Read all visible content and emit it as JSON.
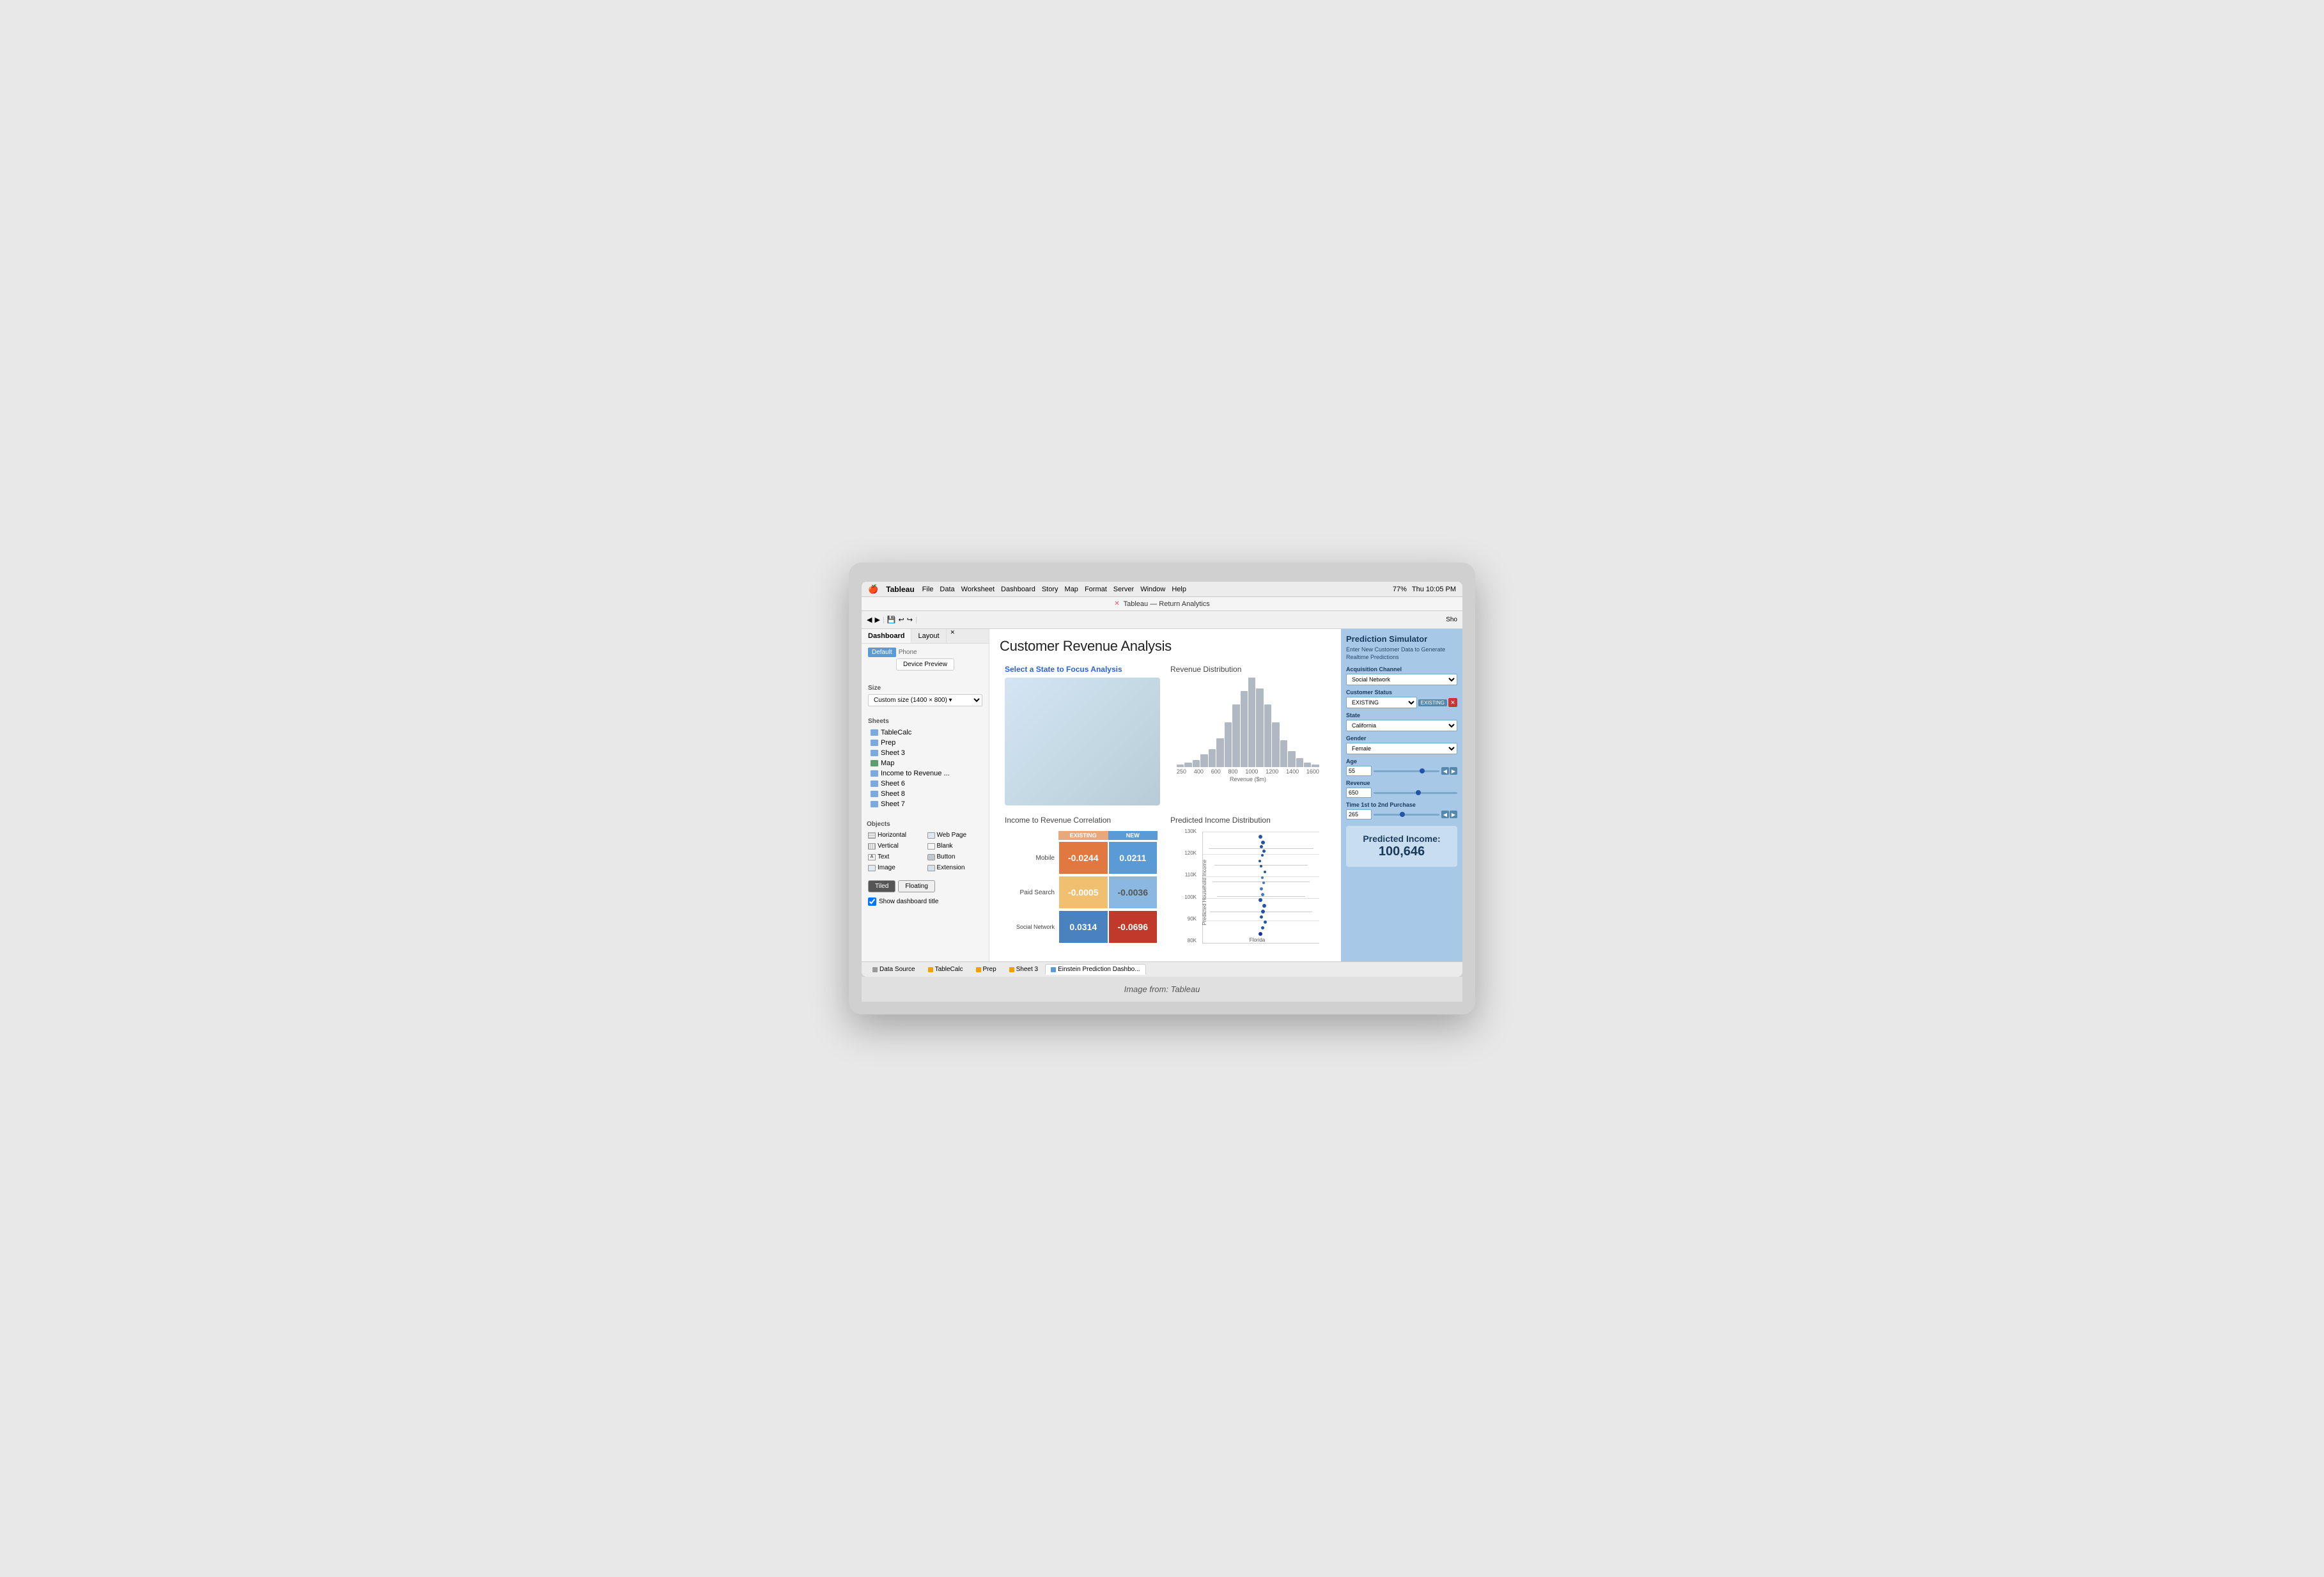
{
  "window": {
    "title": "Tableau — Return Analytics",
    "caption": "Image from: Tableau"
  },
  "menubar": {
    "apple": "⌘",
    "app": "Tableau",
    "menus": [
      "File",
      "Data",
      "Worksheet",
      "Dashboard",
      "Story",
      "Map",
      "Format",
      "Server",
      "Window",
      "Help"
    ],
    "time": "Thu 10:05 PM",
    "battery": "77%"
  },
  "sidebar": {
    "tabs": [
      "Dashboard",
      "Layout"
    ],
    "active_tab": "Dashboard",
    "default_label": "Default",
    "phone_label": "Phone",
    "device_preview_btn": "Device Preview",
    "size_label": "Size",
    "size_value": "Custom size (1400 × 800)  ▾",
    "sheets_label": "Sheets",
    "sheets": [
      {
        "name": "TableCalc",
        "type": "sheet"
      },
      {
        "name": "Prep",
        "type": "sheet"
      },
      {
        "name": "Sheet 3",
        "type": "sheet"
      },
      {
        "name": "Map",
        "type": "map"
      },
      {
        "name": "Income to Revenue ...",
        "type": "sheet"
      },
      {
        "name": "Sheet 6",
        "type": "sheet"
      },
      {
        "name": "Sheet 8",
        "type": "sheet"
      },
      {
        "name": "Sheet 7",
        "type": "sheet"
      }
    ],
    "objects_label": "Objects",
    "objects": [
      {
        "name": "Horizontal",
        "col": 1
      },
      {
        "name": "Web Page",
        "col": 2
      },
      {
        "name": "Vertical",
        "col": 1
      },
      {
        "name": "Blank",
        "col": 2
      },
      {
        "name": "Text",
        "col": 1
      },
      {
        "name": "Button",
        "col": 2
      },
      {
        "name": "Image",
        "col": 1
      },
      {
        "name": "Extension",
        "col": 2
      }
    ],
    "tiled_label": "Tiled",
    "floating_label": "Floating",
    "show_title_label": "Show dashboard title"
  },
  "dashboard": {
    "title": "Customer Revenue Analysis",
    "map_section": {
      "title_prefix": "Select a State to ",
      "title_highlight": "Focus Analysis"
    },
    "revenue_section": {
      "title": "Revenue Distribution",
      "x_labels": [
        "250",
        "400",
        "600",
        "800",
        "1000",
        "1200",
        "1400",
        "1600"
      ],
      "x_axis_label": "Revenue ($m)",
      "bars": [
        2,
        3,
        5,
        8,
        12,
        20,
        35,
        55,
        70,
        85,
        90,
        80,
        60,
        40,
        25,
        15,
        8,
        4,
        2
      ]
    },
    "correlation_section": {
      "title": "Income to Revenue Correlation",
      "col_existing": "EXISTING",
      "col_new": "NEW",
      "rows": [
        {
          "label": "Mobile",
          "existing_val": "-0.0244",
          "new_val": "0.0211"
        },
        {
          "label": "Paid Search",
          "existing_val": "-0.0005",
          "new_val": "-0.0036"
        },
        {
          "label": "Social Network",
          "existing_val": "0.0314",
          "new_val": "-0.0696"
        }
      ]
    },
    "predicted_section": {
      "title": "Predicted Income Distribution",
      "y_labels": [
        "130K",
        "120K",
        "110K",
        "100K",
        "90K",
        "80K"
      ],
      "florida_label": "Florida"
    }
  },
  "prediction_panel": {
    "title": "Prediction Simulator",
    "subtitle": "Enter New Customer Data to Generate Realtime Predictions",
    "fields": [
      {
        "label": "Acquisition Channel",
        "type": "select",
        "value": "Social Network"
      },
      {
        "label": "Customer Status",
        "type": "select_badge",
        "value": "EXISTING",
        "badge": "EXISTING"
      },
      {
        "label": "State",
        "type": "select",
        "value": "California"
      },
      {
        "label": "Gender",
        "type": "select",
        "value": "Female"
      },
      {
        "label": "Age",
        "type": "slider",
        "value": "55",
        "slider_pos": "70"
      },
      {
        "label": "Revenue",
        "type": "slider",
        "value": "650",
        "slider_pos": "50"
      },
      {
        "label": "Time 1st to 2nd Purchase",
        "type": "slider",
        "value": "265",
        "slider_pos": "40"
      }
    ],
    "result_label": "Predicted Income:",
    "result_value": "100,646"
  },
  "bottom_tabs": [
    {
      "name": "Data Source",
      "color": "#aaa",
      "active": false
    },
    {
      "name": "TableCalc",
      "color": "#f0a000",
      "active": false
    },
    {
      "name": "Prep",
      "color": "#f0a000",
      "active": false
    },
    {
      "name": "Sheet 3",
      "color": "#f0a000",
      "active": false
    },
    {
      "name": "Einstein Prediction Dashbo...",
      "color": "#5b9bd5",
      "active": true
    }
  ]
}
